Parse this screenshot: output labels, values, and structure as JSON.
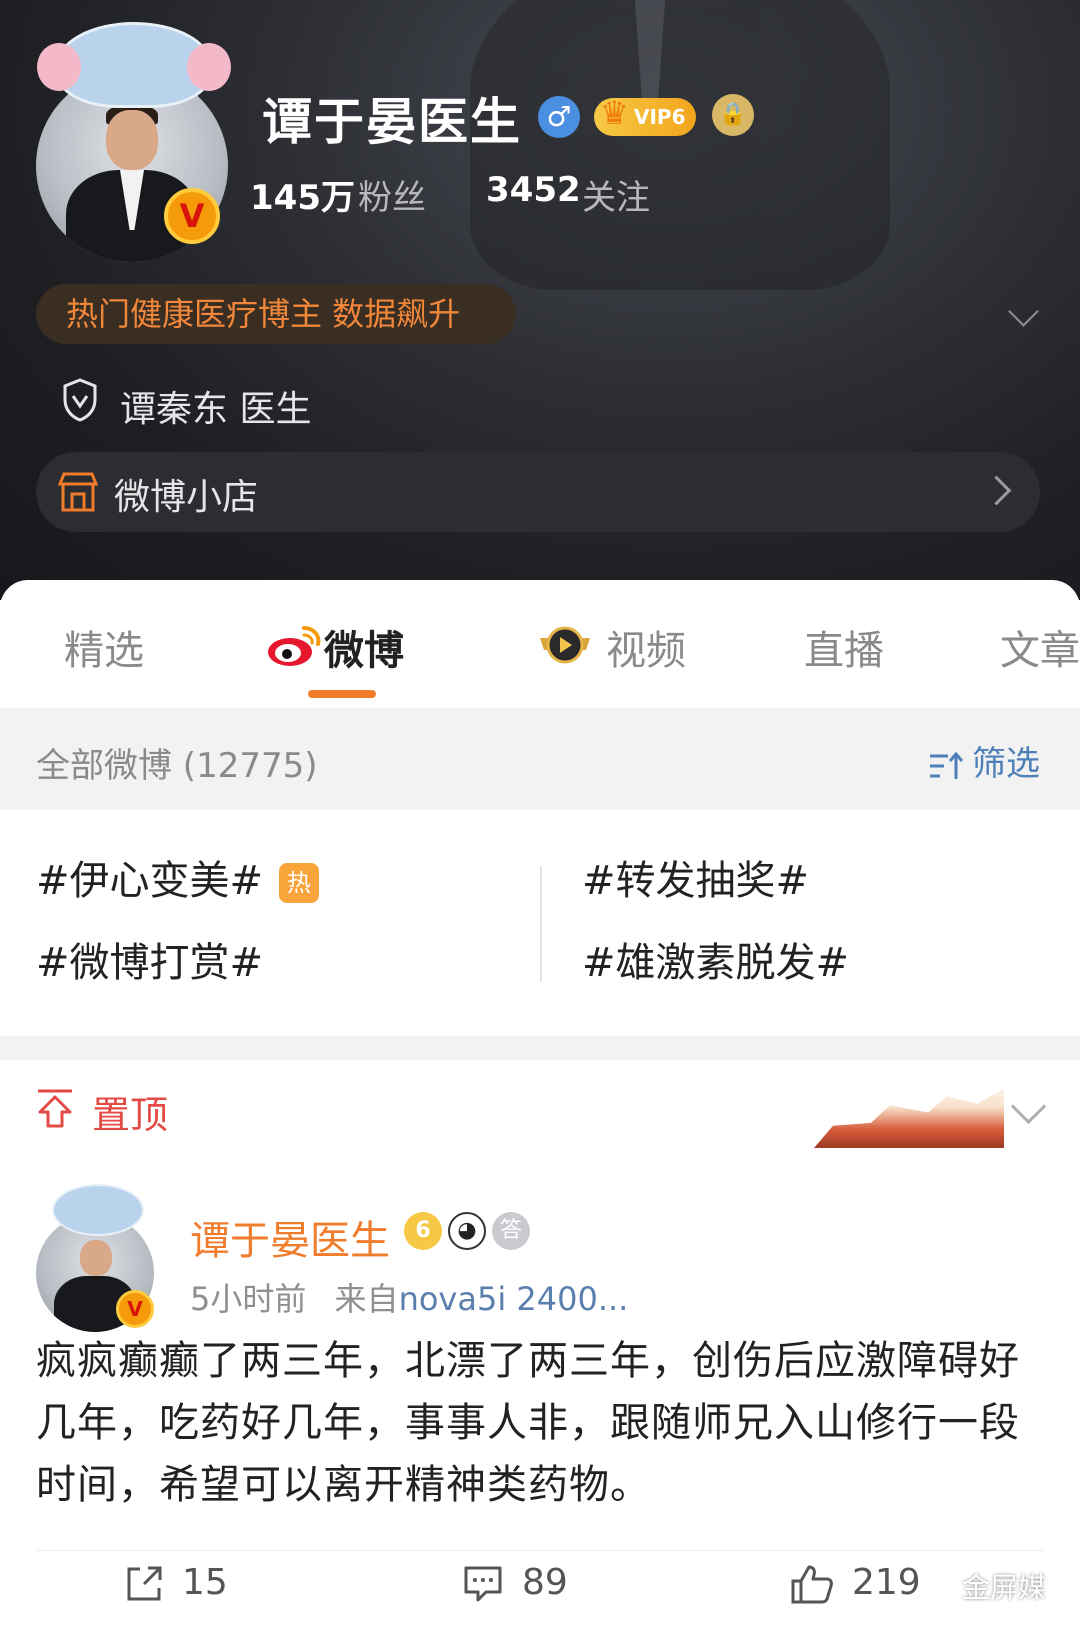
{
  "profile": {
    "name": "谭于晏医生",
    "gender_symbol": "♂",
    "vip_label": "VIP6",
    "fans_count": "145万",
    "fans_label": "粉丝",
    "follow_count": "3452",
    "follow_label": "关注",
    "hot_tag": "热门健康医疗博主 数据飙升",
    "verified_text": "谭秦东 医生",
    "shop_label": "微博小店",
    "avatar_badge": "V"
  },
  "tabs": [
    {
      "label": "精选"
    },
    {
      "label": "微博"
    },
    {
      "label": "视频"
    },
    {
      "label": "直播"
    },
    {
      "label": "文章"
    }
  ],
  "filter": {
    "all_label": "全部微博 (12775)",
    "filter_label": "筛选"
  },
  "hashtags": {
    "items": [
      "#伊心变美#",
      "#转发抽奖#",
      "#微博打赏#",
      "#雄激素脱发#"
    ],
    "hot_badge": "热"
  },
  "pinned": {
    "label": "置顶"
  },
  "post": {
    "author": "谭于晏医生",
    "time": "5小时前",
    "from_label": "来自",
    "source": "nova5i 2400...",
    "body": "疯疯癫癫了两三年，北漂了两三年，创伤后应激障碍好几年，吃药好几年，事事人非，跟随师兄入山修行一段时间，希望可以离开精神类药物。",
    "reposts": "15",
    "comments": "89",
    "likes": "219",
    "badge_vip": "6",
    "badge_medal": "答"
  },
  "watermark": "金屏媒",
  "colors": {
    "accent": "#f37c2a",
    "link": "#4d7fb8",
    "pin": "#e34a45",
    "author": "#f07c2c"
  }
}
